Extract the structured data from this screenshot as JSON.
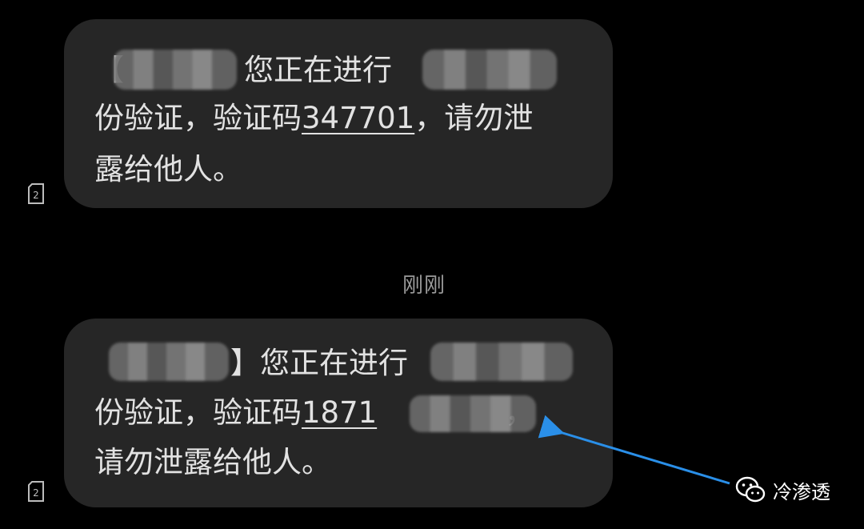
{
  "messages": [
    {
      "line1": {
        "open_bracket": "【",
        "after_sender": "您正在进行"
      },
      "line2": {
        "prefix": "份验证，验证码",
        "code": "347701",
        "suffix": "，请勿泄"
      },
      "line3": "露给他人。",
      "sim_slot": "2"
    },
    {
      "line1": {
        "close_bracket": "】",
        "after_sender": "您正在进行"
      },
      "line2": {
        "prefix": "份验证，验证码",
        "code_visible": "1871",
        "suffix": "，"
      },
      "line3": "请勿泄露给他人。",
      "sim_slot": "2"
    }
  ],
  "timestamp": "刚刚",
  "watermark": {
    "icon": "wechat-icon",
    "text": "冷渗透"
  },
  "annotation": {
    "arrow_color": "#2a8fe8"
  }
}
